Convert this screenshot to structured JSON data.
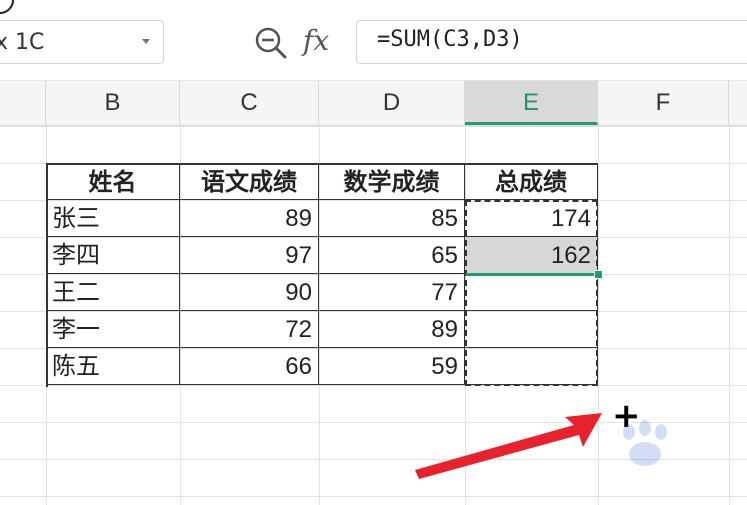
{
  "namebox": {
    "value": "x 1C"
  },
  "formula_bar": {
    "fx_label": "fx",
    "formula": "=SUM(C3,D3)"
  },
  "columns": [
    {
      "letter": "B",
      "selected": false
    },
    {
      "letter": "C",
      "selected": false
    },
    {
      "letter": "D",
      "selected": false
    },
    {
      "letter": "E",
      "selected": true
    },
    {
      "letter": "F",
      "selected": false
    }
  ],
  "table": {
    "headers": [
      "姓名",
      "语文成绩",
      "数学成绩",
      "总成绩"
    ],
    "rows": [
      {
        "name": "张三",
        "chinese": "89",
        "math": "85",
        "total": "174"
      },
      {
        "name": "李四",
        "chinese": "97",
        "math": "65",
        "total": "162"
      },
      {
        "name": "王二",
        "chinese": "90",
        "math": "77",
        "total": ""
      },
      {
        "name": "李一",
        "chinese": "72",
        "math": "89",
        "total": ""
      },
      {
        "name": "陈五",
        "chinese": "66",
        "math": "59",
        "total": ""
      }
    ]
  },
  "cursor": {
    "symbol": "+"
  },
  "colors": {
    "accent": "#1e9e6a",
    "arrow": "#e8222c",
    "selection_fill": "#d7d7d7"
  },
  "icons": [
    "zoom-icon",
    "fx-icon",
    "dropdown-arrow-icon",
    "fill-cursor-icon",
    "pointer-arrow-icon",
    "baidu-paw-icon"
  ]
}
